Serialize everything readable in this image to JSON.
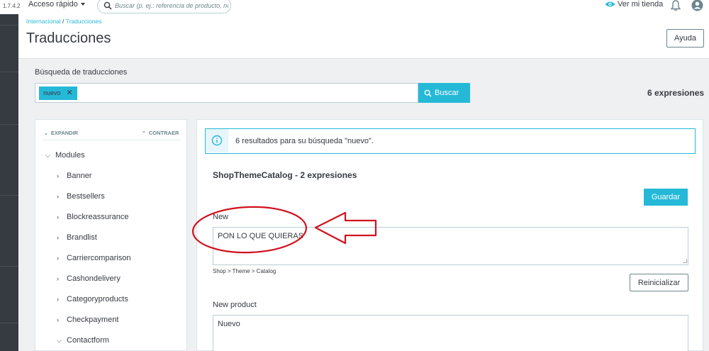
{
  "topbar": {
    "version": "1.7.4.2",
    "quick_access": "Acceso rápido",
    "search_placeholder": "Buscar (p. ej.: referencia de producto, no",
    "view_shop": "Ver mi tienda"
  },
  "breadcrumb": {
    "part1": "Internacional",
    "separator": " / ",
    "part2": "Traducciones"
  },
  "page_title": "Traducciones",
  "help_button": "Ayuda",
  "search": {
    "label": "Búsqueda de traducciones",
    "tag": "nuevo",
    "button": "Buscar",
    "count": "6 expresiones"
  },
  "tree": {
    "expand": "EXPANDIR",
    "collapse": "CONTRAER",
    "root": "Modules",
    "items": [
      "Banner",
      "Bestsellers",
      "Blockreassurance",
      "Brandlist",
      "Carriercomparison",
      "Cashondelivery",
      "Categoryproducts",
      "Checkpayment",
      "Contactform"
    ]
  },
  "main": {
    "alert": "6 resultados para su búsqueda \"nuevo\".",
    "domain_title": "ShopThemeCatalog - 2 expresiones",
    "save_button": "Guardar",
    "fields": [
      {
        "label": "New",
        "value": "PON LO QUE QUIERAS",
        "path": "Shop > Theme > Catalog"
      },
      {
        "label": "New product",
        "value": "Nuevo"
      }
    ],
    "reset_button": "Reinicializar"
  },
  "colors": {
    "accent": "#25b9d7",
    "annotation": "#d0121e",
    "sidebar": "#363a41"
  }
}
